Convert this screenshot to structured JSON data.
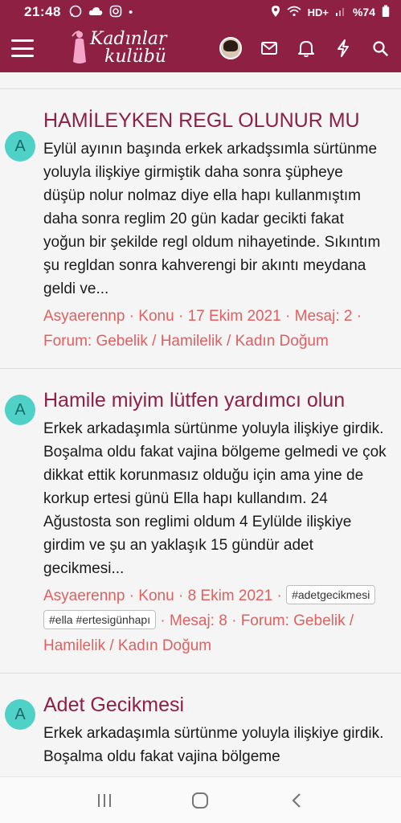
{
  "status_bar": {
    "time": "21:48",
    "network": "HD+",
    "battery": "%74"
  },
  "app_bar": {
    "logo_line1": "Kadınlar",
    "logo_line2": "kulübü"
  },
  "results": [
    {
      "avatar_letter": "A",
      "title": "HAMİLEYKEN REGL OLUNUR MU",
      "snippet": "Eylül ayının başında erkek arkadşsımla sürtünme yoluyla ilişkiye girmiştik daha sonra şüpheye düşüp nolur nolmaz diye ella hapı kullanmıştım daha sonra reglim 20 gün kadar gecikti fakat yoğun bir şekilde regl oldum nihayetinde. Sıkıntım şu regldan sonra kahverengi bir akıntı meydana geldi ve...",
      "author": "Asyaerennp",
      "type": "Konu",
      "date": "17 Ekim 2021",
      "messages": "Mesaj: 2",
      "forum": "Forum: Gebelik / Hamilelik / Kadın Doğum"
    },
    {
      "avatar_letter": "A",
      "title": "Hamile miyim lütfen yardımcı olun",
      "snippet": "Erkek arkadaşımla sürtünme yoluyla ilişkiye girdik. Boşalma oldu fakat vajina bölgeme gelmedi ve çok dikkat ettik korunmasız olduğu için ama yine de korkup ertesi günü Ella hapı kullandım. 24 Ağustosta son reglimi oldum 4 Eylülde ilişkiye girdim ve şu an yaklaşık 15 gündür adet gecikmesi...",
      "author": "Asyaerennp",
      "type": "Konu",
      "date": "8 Ekim 2021",
      "tags": [
        "#adetgecikmesi",
        "#ella #ertesigünhapı"
      ],
      "messages": "Mesaj: 8",
      "forum": "Forum: Gebelik / Hamilelik / Kadın Doğum"
    },
    {
      "avatar_letter": "A",
      "title": "Adet Gecikmesi",
      "snippet": "Erkek arkadaşımla sürtünme yoluyla ilişkiye girdik. Boşalma oldu fakat vajina bölgeme"
    }
  ],
  "colors": {
    "brand": "#8e2044",
    "meta": "#e06060",
    "avatar": "#4fd1c8"
  },
  "icons": [
    "whatsapp-icon",
    "cloud-icon",
    "instagram-icon",
    "location-icon",
    "wifi-icon",
    "signal-icon",
    "battery-icon",
    "menu-icon",
    "mail-icon",
    "bell-icon",
    "lightning-icon",
    "search-icon",
    "recents-icon",
    "home-icon",
    "back-icon"
  ]
}
